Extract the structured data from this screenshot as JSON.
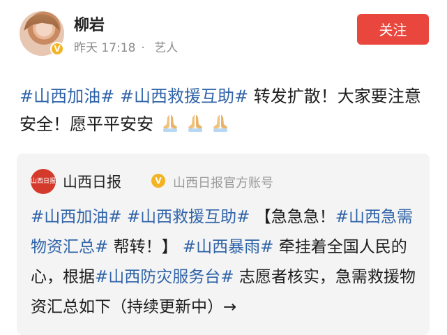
{
  "author": {
    "name": "柳岩",
    "time": "昨天 17:18",
    "separator": "·",
    "role": "艺人",
    "verified_mark": "V",
    "avatar": "avatar"
  },
  "follow_button": {
    "label": "关注",
    "color": "#e9473d"
  },
  "post": {
    "tag1": "#山西加油#",
    "tag2": "#山西救援互助#",
    "text1": " 转发扩散！大家要注意安全！愿平平安安",
    "emoji": [
      "prayer-hands-icon",
      "prayer-hands-icon",
      "prayer-hands-icon"
    ]
  },
  "repost": {
    "source_name": "山西日报",
    "verified_mark": "V",
    "source_desc": "山西日报官方账号",
    "logo_text": "山西日报",
    "tag1": "#山西加油#",
    "tag2": "#山西救援互助#",
    "text1": "【急急急！",
    "tag3": "#山西急需物资汇总#",
    "text2": " 帮转！】",
    "tag4": "#山西暴雨#",
    "text3": " 牵挂着全国人民的心，根据",
    "tag5": "#山西防灾服务台#",
    "text4": " 志愿者核实，急需救援物资汇总如下（持续更新中）→"
  },
  "colors": {
    "tag": "#2f63a8",
    "meta": "#8c8c8c"
  }
}
